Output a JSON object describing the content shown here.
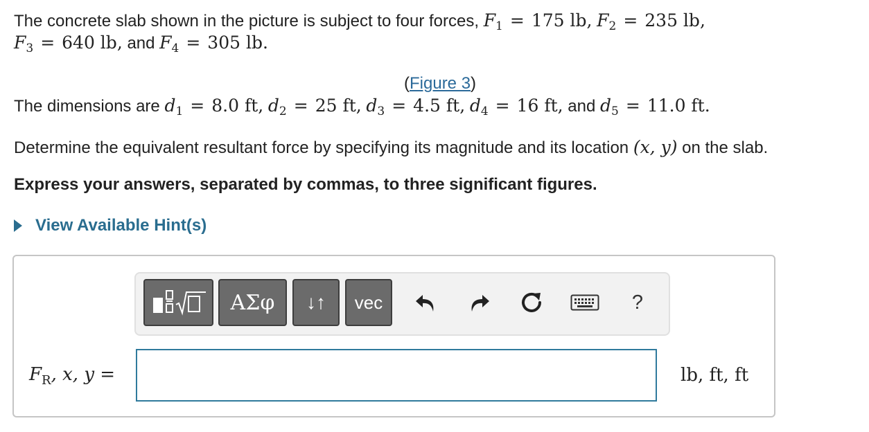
{
  "problem": {
    "intro_text": "The concrete slab shown in the picture is subject to four forces,",
    "F1_value": "175 lb",
    "F2_value": "235 lb",
    "F3_value": "640 lb",
    "F4_value": "305 lb",
    "and_text": "and",
    "period": ".",
    "figure_link": "Figure 3",
    "dims_intro": "The dimensions are",
    "d1_value": "8.0 ft",
    "d2_value": "25 ft",
    "d3_value": "4.5 ft",
    "d4_value": "16 ft",
    "d5_value": "11.0 ft",
    "question_before": "Determine the equivalent resultant force by specifying its magnitude and its location",
    "question_location": "(x, y)",
    "question_after": "on the slab.",
    "instruction": "Express your answers, separated by commas, to three significant figures."
  },
  "hint": {
    "label": "View Available Hint(s)"
  },
  "toolbar": {
    "greek_label": "ΑΣφ",
    "updown_label": "↓↑",
    "vec_label": "vec",
    "help_label": "?",
    "icons": [
      "templates-icon",
      "undo-icon",
      "redo-icon",
      "reset-icon",
      "keyboard-icon",
      "help-icon"
    ]
  },
  "answer": {
    "label_F": "F",
    "label_sub": "R",
    "label_rest": ", x, y =",
    "input_value": "",
    "units": "lb, ft, ft"
  },
  "colors": {
    "link": "#2b6a9a",
    "hint": "#2a6d8f",
    "input_border": "#2f7a9c",
    "toolbar_button": "#6b6b6b"
  }
}
